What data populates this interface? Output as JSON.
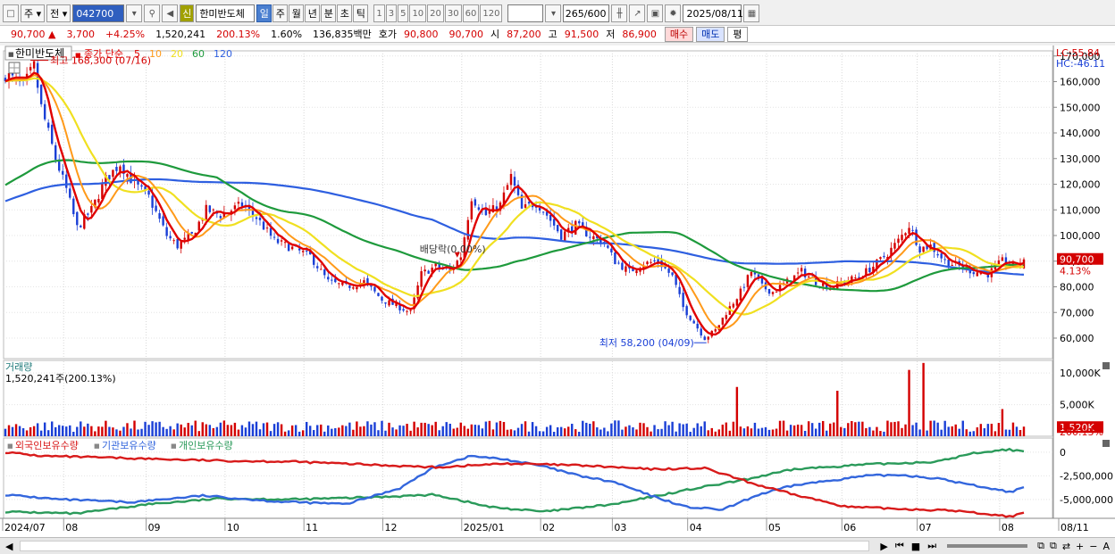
{
  "toolbar": {
    "market": "주",
    "prev": "전",
    "code": "042700",
    "badge": "신",
    "stock_name": "한미반도체",
    "periods": [
      "일",
      "주",
      "월",
      "년",
      "분",
      "초",
      "틱"
    ],
    "active_period": "일",
    "intervals": [
      "1",
      "3",
      "5",
      "10",
      "20",
      "30",
      "60",
      "120"
    ],
    "count": "265",
    "count_total": "/600",
    "date": "2025/08/11"
  },
  "quote": {
    "price": "90,700",
    "change": "3,700",
    "change_pct": "+4.25%",
    "volume": "1,520,241",
    "vol_ratio": "200.13%",
    "turnover": "1.60%",
    "amount": "136,835백만",
    "bid_label": "호가",
    "bid1": "90,800",
    "bid2": "90,700",
    "open_label": "시",
    "open": "87,200",
    "high_label": "고",
    "high": "91,500",
    "low_label": "저",
    "low": "86,900",
    "buy": "매수",
    "sell": "매도",
    "avg": "평"
  },
  "colors": {
    "up": "#d40000",
    "down": "#1a3fd6",
    "ma5": "#e00000",
    "ma10": "#ff9a1a",
    "ma20": "#f0e020",
    "ma60": "#1e9a3c",
    "ma120": "#2e5fe0",
    "foreign": "#d81a1a",
    "institution": "#3366dd",
    "individual": "#2a9a5a"
  },
  "chart_data": [
    {
      "type": "candlestick",
      "title": "한미반도체",
      "legend_label": "종가 단순",
      "ma_periods": [
        "5",
        "10",
        "20",
        "60",
        "120"
      ],
      "ylim": [
        52000,
        172000
      ],
      "y_ticks": [
        60000,
        70000,
        80000,
        90000,
        100000,
        110000,
        120000,
        130000,
        140000,
        150000,
        160000,
        170000
      ],
      "y_tick_labels": [
        "60,000",
        "70,000",
        "80,000",
        "90,000",
        "100,000",
        "110,000",
        "120,000",
        "130,000",
        "140,000",
        "150,000",
        "160,000",
        "170,000"
      ],
      "x_labels": [
        "2024/07",
        "08",
        "09",
        "10",
        "11",
        "12",
        "2025/01",
        "02",
        "03",
        "04",
        "05",
        "06",
        "07",
        "08",
        "08/11"
      ],
      "x_label_positions": [
        0,
        17,
        40,
        62,
        84,
        106,
        128,
        150,
        170,
        191,
        213,
        234,
        255,
        278,
        296
      ],
      "n_days": 285,
      "close_keyframes": [
        [
          0,
          163000
        ],
        [
          5,
          158000
        ],
        [
          8,
          166000
        ],
        [
          10,
          150000
        ],
        [
          14,
          130000
        ],
        [
          17,
          118000
        ],
        [
          20,
          103000
        ],
        [
          24,
          110000
        ],
        [
          28,
          122000
        ],
        [
          32,
          128000
        ],
        [
          36,
          120000
        ],
        [
          40,
          115000
        ],
        [
          45,
          100000
        ],
        [
          48,
          96000
        ],
        [
          52,
          100000
        ],
        [
          56,
          110000
        ],
        [
          60,
          108000
        ],
        [
          66,
          112000
        ],
        [
          70,
          107000
        ],
        [
          75,
          98000
        ],
        [
          80,
          95000
        ],
        [
          85,
          92000
        ],
        [
          90,
          82000
        ],
        [
          95,
          80000
        ],
        [
          100,
          82000
        ],
        [
          105,
          75000
        ],
        [
          110,
          72000
        ],
        [
          113,
          70000
        ],
        [
          116,
          85000
        ],
        [
          120,
          88000
        ],
        [
          124,
          86000
        ],
        [
          127,
          92000
        ],
        [
          130,
          115000
        ],
        [
          134,
          108000
        ],
        [
          138,
          112000
        ],
        [
          141,
          123000
        ],
        [
          144,
          110000
        ],
        [
          148,
          113000
        ],
        [
          151,
          108000
        ],
        [
          155,
          100000
        ],
        [
          159,
          104000
        ],
        [
          163,
          100000
        ],
        [
          167,
          97000
        ],
        [
          170,
          90000
        ],
        [
          174,
          86000
        ],
        [
          178,
          89000
        ],
        [
          182,
          90000
        ],
        [
          186,
          84000
        ],
        [
          189,
          72000
        ],
        [
          192,
          66000
        ],
        [
          195,
          60000
        ],
        [
          198,
          63000
        ],
        [
          201,
          70000
        ],
        [
          205,
          78000
        ],
        [
          208,
          86000
        ],
        [
          211,
          80000
        ],
        [
          214,
          78000
        ],
        [
          218,
          82000
        ],
        [
          222,
          86000
        ],
        [
          226,
          82000
        ],
        [
          230,
          80000
        ],
        [
          234,
          82000
        ],
        [
          238,
          84000
        ],
        [
          242,
          88000
        ],
        [
          246,
          93000
        ],
        [
          249,
          98000
        ],
        [
          252,
          104000
        ],
        [
          255,
          95000
        ],
        [
          258,
          96000
        ],
        [
          262,
          90000
        ],
        [
          266,
          88000
        ],
        [
          270,
          86000
        ],
        [
          274,
          85000
        ],
        [
          278,
          90000
        ],
        [
          281,
          88000
        ],
        [
          284,
          90700
        ]
      ],
      "annotations": [
        {
          "label": "최고 168,300 (07/16)",
          "day": 6,
          "value": 168300
        },
        {
          "label": "배당락(0.00%)",
          "day": 126,
          "value": 90000
        },
        {
          "label": "최저 58,200 (04/09)",
          "day": 196,
          "value": 58200
        }
      ],
      "current_price": "90,700",
      "current_pct": "4.13%",
      "lc_label": "LC:55.84",
      "hc_label": "HC:-46.11"
    },
    {
      "type": "bar",
      "title": "거래량",
      "subtitle": "1,520,241주(200.13%)",
      "ylim": [
        0,
        12000
      ],
      "y_ticks": [
        5000,
        10000
      ],
      "y_tick_labels": [
        "5,000K",
        "10,000K"
      ],
      "current_label": "1,520K",
      "current_pct": "200.13%",
      "spikes": [
        [
          204,
          7800
        ],
        [
          232,
          7200
        ],
        [
          252,
          10500
        ],
        [
          256,
          11600
        ],
        [
          278,
          4300
        ]
      ]
    },
    {
      "type": "line",
      "series_names": [
        "외국인보유수량",
        "기관보유수량",
        "개인보유수량"
      ],
      "ylim": [
        -7000000,
        1500000
      ],
      "y_ticks": [
        0,
        -2500000,
        -5000000
      ],
      "y_tick_labels": [
        "0",
        "-2,500,000",
        "-5,000,000"
      ],
      "foreign": [
        [
          0,
          0
        ],
        [
          10,
          -400000
        ],
        [
          20,
          -500000
        ],
        [
          40,
          -700000
        ],
        [
          60,
          -900000
        ],
        [
          80,
          -1000000
        ],
        [
          100,
          -1300000
        ],
        [
          120,
          -1600000
        ],
        [
          140,
          -1200000
        ],
        [
          160,
          -1400000
        ],
        [
          180,
          -1800000
        ],
        [
          195,
          -1700000
        ],
        [
          210,
          -3500000
        ],
        [
          220,
          -4500000
        ],
        [
          235,
          -5800000
        ],
        [
          250,
          -6000000
        ],
        [
          265,
          -6200000
        ],
        [
          280,
          -6800000
        ],
        [
          284,
          -6500000
        ]
      ],
      "institution": [
        [
          0,
          -4500000
        ],
        [
          15,
          -5000000
        ],
        [
          35,
          -5300000
        ],
        [
          55,
          -4600000
        ],
        [
          75,
          -5200000
        ],
        [
          95,
          -5500000
        ],
        [
          110,
          -3800000
        ],
        [
          120,
          -1500000
        ],
        [
          130,
          -400000
        ],
        [
          140,
          -800000
        ],
        [
          150,
          -1500000
        ],
        [
          160,
          -2500000
        ],
        [
          170,
          -3200000
        ],
        [
          180,
          -4600000
        ],
        [
          190,
          -5800000
        ],
        [
          200,
          -6100000
        ],
        [
          210,
          -4500000
        ],
        [
          220,
          -3500000
        ],
        [
          230,
          -3000000
        ],
        [
          240,
          -2500000
        ],
        [
          250,
          -2400000
        ],
        [
          260,
          -2800000
        ],
        [
          270,
          -3500000
        ],
        [
          280,
          -4200000
        ],
        [
          284,
          -3800000
        ]
      ],
      "individual": [
        [
          0,
          -6300000
        ],
        [
          20,
          -6500000
        ],
        [
          40,
          -5500000
        ],
        [
          60,
          -4900000
        ],
        [
          80,
          -5000000
        ],
        [
          100,
          -4800000
        ],
        [
          120,
          -4500000
        ],
        [
          135,
          -5800000
        ],
        [
          150,
          -6300000
        ],
        [
          170,
          -5500000
        ],
        [
          190,
          -4000000
        ],
        [
          205,
          -3000000
        ],
        [
          220,
          -1800000
        ],
        [
          240,
          -1300000
        ],
        [
          260,
          -1000000
        ],
        [
          270,
          -100000
        ],
        [
          280,
          300000
        ],
        [
          284,
          0
        ]
      ]
    }
  ]
}
